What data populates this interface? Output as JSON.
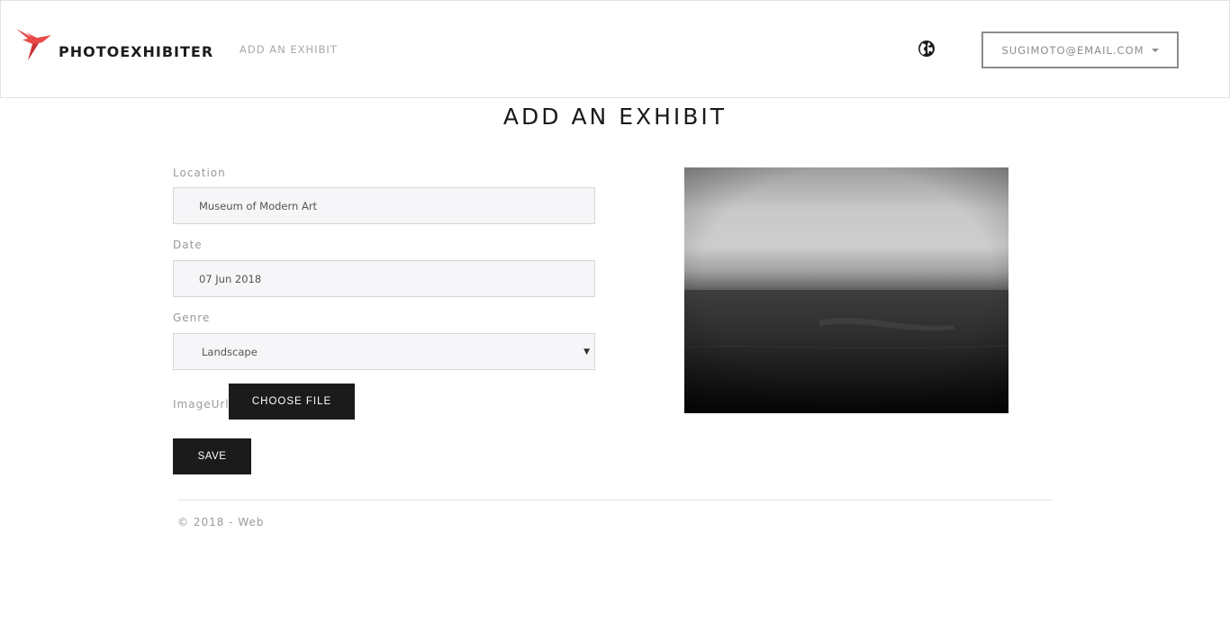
{
  "header": {
    "brand": "PHOTOEXHIBITER",
    "nav_link": "ADD AN EXHIBIT",
    "user_email": "SUGIMOTO@EMAIL.COM"
  },
  "page": {
    "title": "ADD AN EXHIBIT"
  },
  "form": {
    "location_label": "Location",
    "location_value": "Museum of Modern Art",
    "date_label": "Date",
    "date_value": "07 Jun 2018",
    "genre_label": "Genre",
    "genre_value": "Landscape",
    "image_label": "ImageUrl",
    "choose_file_label": "CHOOSE FILE",
    "save_label": "SAVE"
  },
  "footer": {
    "copyright": "© 2018 - Web"
  },
  "icons": {
    "logo": "bird-logo-icon",
    "globe": "globe-icon",
    "dropdown": "caret-down-icon"
  },
  "colors": {
    "logo_red": "#e84a4a",
    "dark_button": "#1b1b1b",
    "muted_text": "#9a9a9a"
  }
}
